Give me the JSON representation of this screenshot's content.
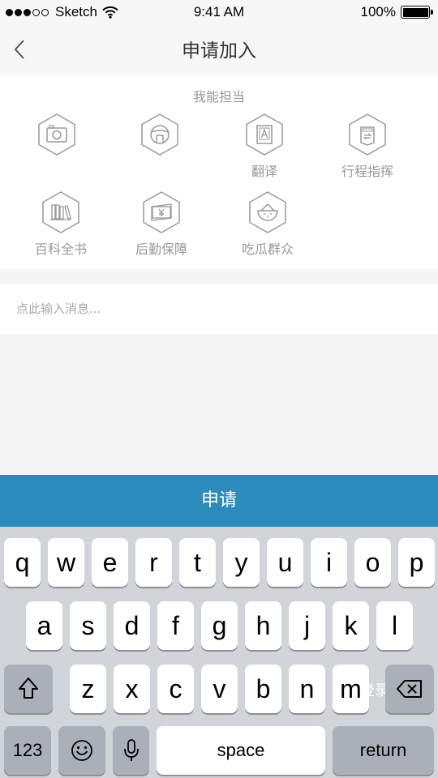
{
  "status_bar": {
    "carrier": "Sketch",
    "time": "9:41 AM",
    "battery": "100%"
  },
  "nav": {
    "title": "申请加入"
  },
  "skills": {
    "heading": "我能担当",
    "items": [
      {
        "label": "",
        "icon": "camera-icon"
      },
      {
        "label": "",
        "icon": "steering-wheel-icon"
      },
      {
        "label": "翻译",
        "icon": "translate-icon"
      },
      {
        "label": "行程指挥",
        "icon": "itinerary-icon"
      },
      {
        "label": "百科全书",
        "icon": "books-icon"
      },
      {
        "label": "后勤保障",
        "icon": "money-icon"
      },
      {
        "label": "吃瓜群众",
        "icon": "watermelon-icon"
      }
    ]
  },
  "message": {
    "placeholder": "点此输入消息..."
  },
  "apply_button": {
    "label": "申请"
  },
  "keyboard": {
    "row1": [
      "q",
      "w",
      "e",
      "r",
      "t",
      "y",
      "u",
      "i",
      "o",
      "p"
    ],
    "row2": [
      "a",
      "s",
      "d",
      "f",
      "g",
      "h",
      "j",
      "k",
      "l"
    ],
    "row3": [
      "z",
      "x",
      "c",
      "v",
      "b",
      "n",
      "m"
    ],
    "numbers_label": "123",
    "space_label": "space",
    "return_label": "return",
    "ghost_text": "登录"
  }
}
